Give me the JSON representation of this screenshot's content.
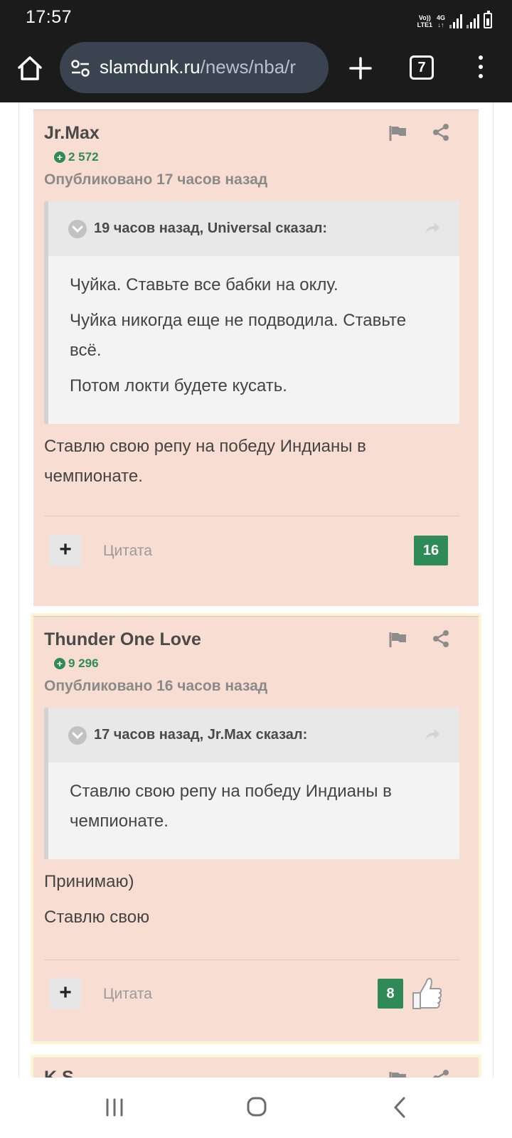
{
  "status_bar": {
    "time": "17:57",
    "volte": "Vo))",
    "lte": "LTE1",
    "net": "4G",
    "net_arrows": "↓↑"
  },
  "browser": {
    "url_main": "slamdunk.ru",
    "url_path": "/news/nba/r",
    "tab_count": "7"
  },
  "posts": [
    {
      "author": "Jr.Max",
      "reputation": "2 572",
      "published": "Опубликовано 17 часов назад",
      "quote": {
        "header": "19 часов назад, Universal сказал:",
        "lines": [
          "Чуйка. Ставьте все бабки на оклу.",
          "Чуйка никогда еще не подводила. Ставьте всё.",
          "Потом локти будете кусать."
        ]
      },
      "text": [
        "Ставлю свою репу на победу Индианы в чемпионате."
      ],
      "vote_label": "+",
      "cite_label": "Цитата",
      "rep_count": "16"
    },
    {
      "author": "Thunder One Love",
      "reputation": "9 296",
      "published": "Опубликовано 16 часов назад",
      "quote": {
        "header": "17 часов назад, Jr.Max сказал:",
        "lines": [
          "Ставлю свою репу на победу Индианы в чемпионате."
        ]
      },
      "text": [
        "Принимаю)",
        "Ставлю свою"
      ],
      "vote_label": "+",
      "cite_label": "Цитата",
      "rep_count": "8"
    },
    {
      "author": "K.S"
    }
  ],
  "colors": {
    "post_bg": "#f7ddd2",
    "rep_green": "#2e8b57",
    "browser_bg": "#1b1b1b",
    "url_bg": "#3a4450"
  }
}
